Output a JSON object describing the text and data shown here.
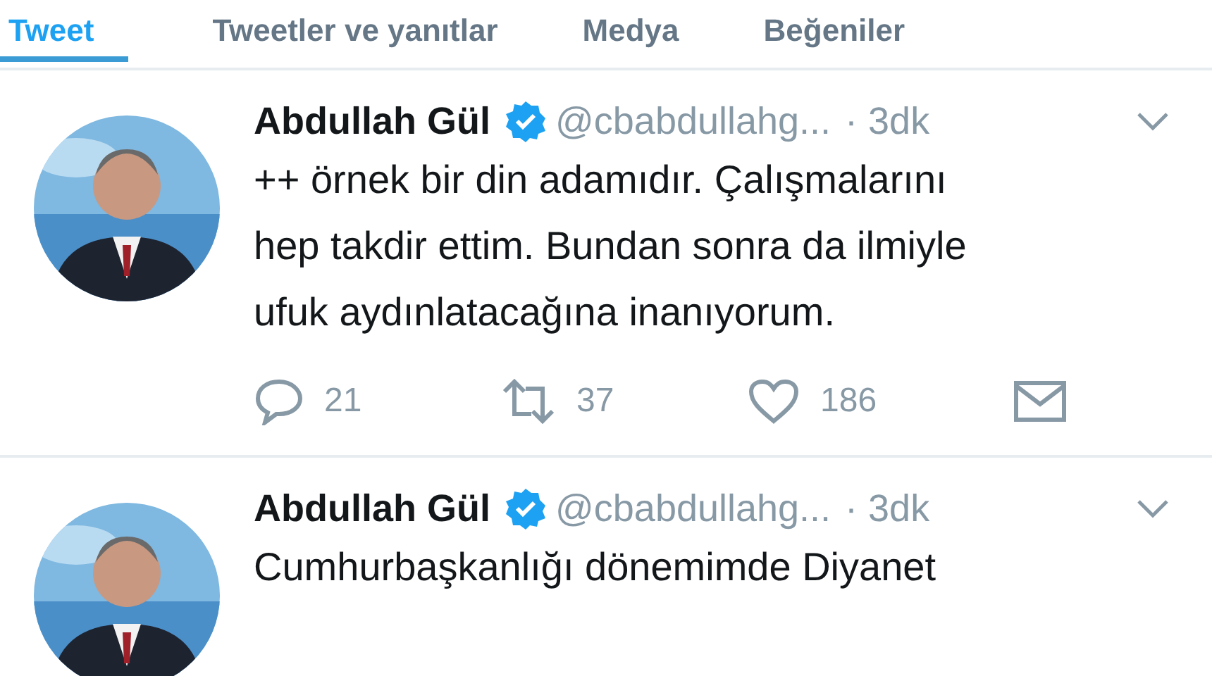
{
  "tabs": [
    {
      "label": "Tweet",
      "selected": true
    },
    {
      "label": "Tweetler ve yanıtlar",
      "selected": false
    },
    {
      "label": "Medya",
      "selected": false
    },
    {
      "label": "Beğeniler",
      "selected": false
    }
  ],
  "tweets": [
    {
      "name": "Abdullah Gül",
      "verified": true,
      "handle": "@cbabdullahg...",
      "time": "· 3dk",
      "lines": [
        "++ örnek bir din adamıdır. Çalışmalarını",
        "hep takdir ettim. Bundan sonra da ilmiyle",
        "ufuk aydınlatacağına inanıyorum."
      ],
      "actions": [
        {
          "kind": "reply",
          "count": "21"
        },
        {
          "kind": "retweet",
          "count": "37"
        },
        {
          "kind": "like",
          "count": "186"
        },
        {
          "kind": "message"
        }
      ]
    },
    {
      "name": "Abdullah Gül",
      "verified": true,
      "handle": "@cbabdullahg...",
      "time": "· 3dk",
      "lines": [
        "Cumhurbaşkanlığı dönemimde Diyanet"
      ]
    }
  ]
}
